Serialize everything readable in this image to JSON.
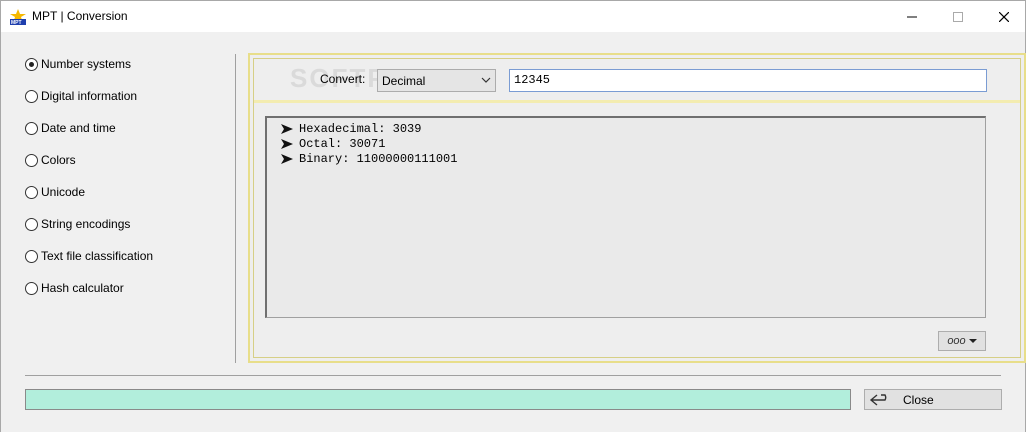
{
  "window": {
    "title": "MPT | Conversion",
    "watermark": "SOFTPEDIA"
  },
  "sidebar": {
    "options": [
      {
        "label": "Number systems",
        "checked": true
      },
      {
        "label": "Digital information",
        "checked": false
      },
      {
        "label": "Date and time",
        "checked": false
      },
      {
        "label": "Colors",
        "checked": false
      },
      {
        "label": "Unicode",
        "checked": false
      },
      {
        "label": "String encodings",
        "checked": false
      },
      {
        "label": "Text file classification",
        "checked": false
      },
      {
        "label": "Hash calculator",
        "checked": false
      }
    ]
  },
  "convert": {
    "label": "Convert:",
    "selected": "Decimal",
    "input_value": "12345"
  },
  "output": {
    "lines": [
      "Hexadecimal: 3039",
      "Octal: 30071",
      "Binary: 11000000111001"
    ],
    "bullet_icon": "arrow-bullet-icon"
  },
  "more_button": {
    "label": "ooo"
  },
  "footer": {
    "close_label": "Close"
  },
  "colors": {
    "status_bar": "#b2eedc",
    "frame_accent": "#e8de8a"
  }
}
